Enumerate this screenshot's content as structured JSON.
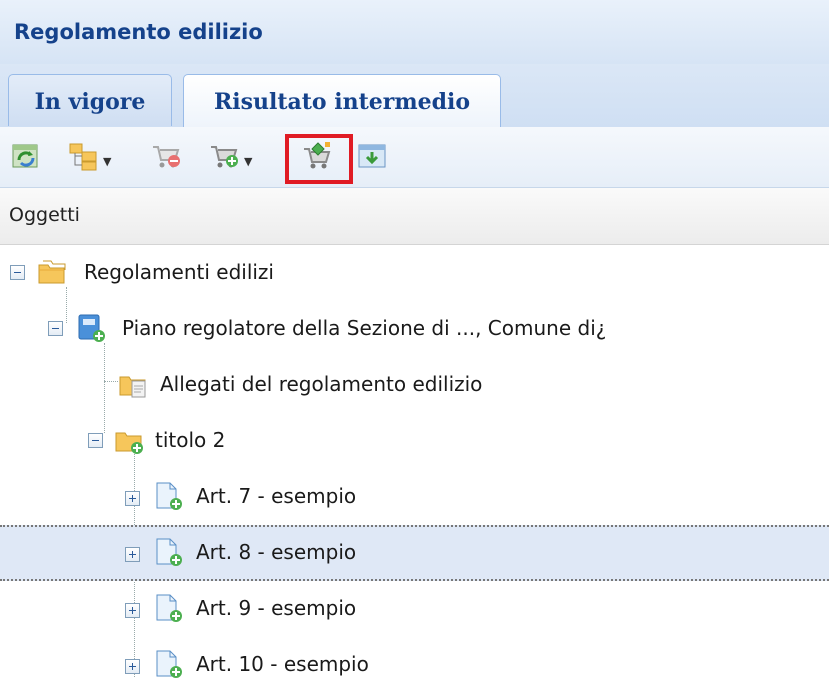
{
  "panel": {
    "title": "Regolamento edilizio"
  },
  "tabs": [
    {
      "label": "In vigore",
      "active": false
    },
    {
      "label": "Risultato intermedio",
      "active": true
    }
  ],
  "toolbar": {
    "buttons": [
      {
        "icon": "refresh-icon"
      },
      {
        "icon": "folder-tree-icon",
        "dropdown": true
      },
      {
        "icon": "cart-remove-icon",
        "disabled": true
      },
      {
        "icon": "cart-add-icon",
        "dropdown": true
      },
      {
        "icon": "cart-highlighted-icon",
        "highlighted": true
      },
      {
        "icon": "download-icon"
      }
    ],
    "highlight_color": "#e01b24"
  },
  "grid": {
    "column_header": "Oggetti"
  },
  "tree": {
    "nodes": [
      {
        "label": "Regolamenti edilizi",
        "level": 0,
        "expanded": true,
        "icon": "folders-icon"
      },
      {
        "label": "Piano regolatore della Sezione di ..., Comune di¿",
        "level": 1,
        "expanded": true,
        "icon": "document-add-icon"
      },
      {
        "label": "Allegati del regolamento edilizio",
        "level": 2,
        "expanded": null,
        "icon": "folder-doc-icon"
      },
      {
        "label": "titolo 2",
        "level": 2,
        "expanded": true,
        "icon": "folder-add-icon"
      },
      {
        "label": "Art. 7 - esempio",
        "level": 3,
        "expanded": false,
        "icon": "page-add-icon"
      },
      {
        "label": "Art. 8 - esempio",
        "level": 3,
        "expanded": false,
        "icon": "page-add-icon",
        "selected": true
      },
      {
        "label": "Art. 9 - esempio",
        "level": 3,
        "expanded": false,
        "icon": "page-add-icon"
      },
      {
        "label": "Art. 10 - esempio",
        "level": 3,
        "expanded": false,
        "icon": "page-add-icon"
      }
    ]
  },
  "colors": {
    "title_text": "#15428b",
    "selection_bg": "#dfe8f6"
  }
}
